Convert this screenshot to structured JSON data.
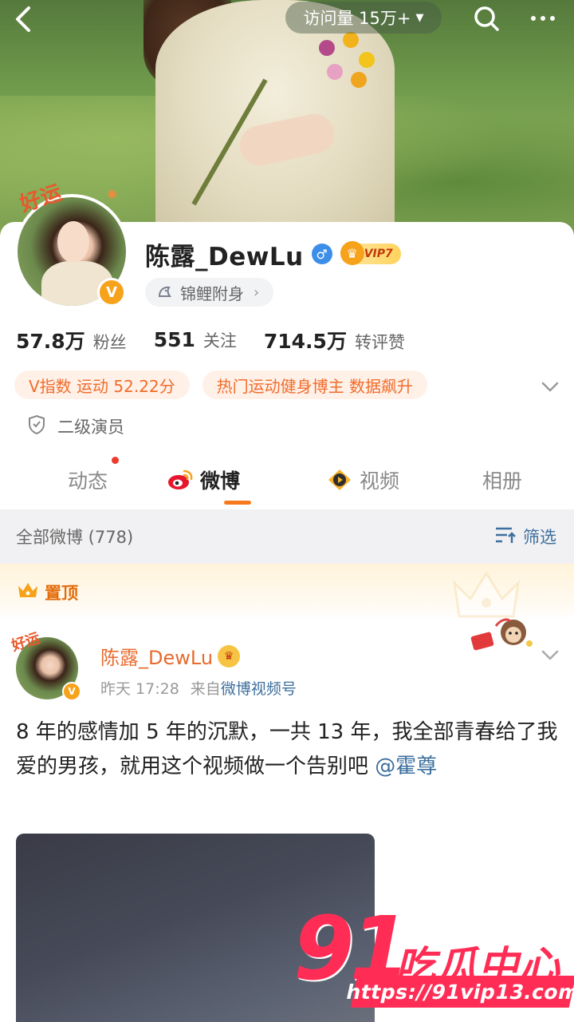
{
  "header": {
    "visit_label": "访问量 15万+",
    "icons": [
      "back-icon",
      "search-icon",
      "more-icon"
    ]
  },
  "profile": {
    "lucky_tag": "好运",
    "name": "陈露_DewLu",
    "gender_symbol": "♂",
    "vip_label": "VIP7",
    "koi_label": "锦鲤附身",
    "stats": [
      {
        "num": "57.8万",
        "label": "粉丝"
      },
      {
        "num": "551",
        "label": "关注"
      },
      {
        "num": "714.5万",
        "label": "转评赞"
      }
    ],
    "tags": [
      "V指数 运动 52.22分",
      "热门运动健身博主 数据飙升"
    ],
    "identity": "二级演员"
  },
  "tabs": [
    {
      "label": "动态",
      "active": false,
      "dot": true
    },
    {
      "label": "微博",
      "active": true,
      "dot": false
    },
    {
      "label": "视频",
      "active": false,
      "dot": false
    },
    {
      "label": "相册",
      "active": false,
      "dot": false
    }
  ],
  "feed": {
    "section_title": "全部微博 (778)",
    "filter_label": "筛选",
    "pinned_label": "置顶"
  },
  "post": {
    "lucky_tag": "好运",
    "author": "陈露_DewLu",
    "time": "昨天 17:28",
    "source_prefix": "来自",
    "source": "微博视频号",
    "text_main": "8 年的感情加 5 年的沉默，一共 13 年，我全部青春给了我爱的男孩，就用这个视频做一个告别吧 ",
    "mention": "@霍尊"
  },
  "watermark": {
    "number": "91",
    "brand": "吃瓜中心",
    "url": "https://91vip13.com"
  },
  "colors": {
    "accent": "#f7791e",
    "link": "#3d6f9e",
    "tag_bg": "#fff1e8",
    "tag_text": "#f26b2a",
    "watermark": "#ff2d55"
  }
}
